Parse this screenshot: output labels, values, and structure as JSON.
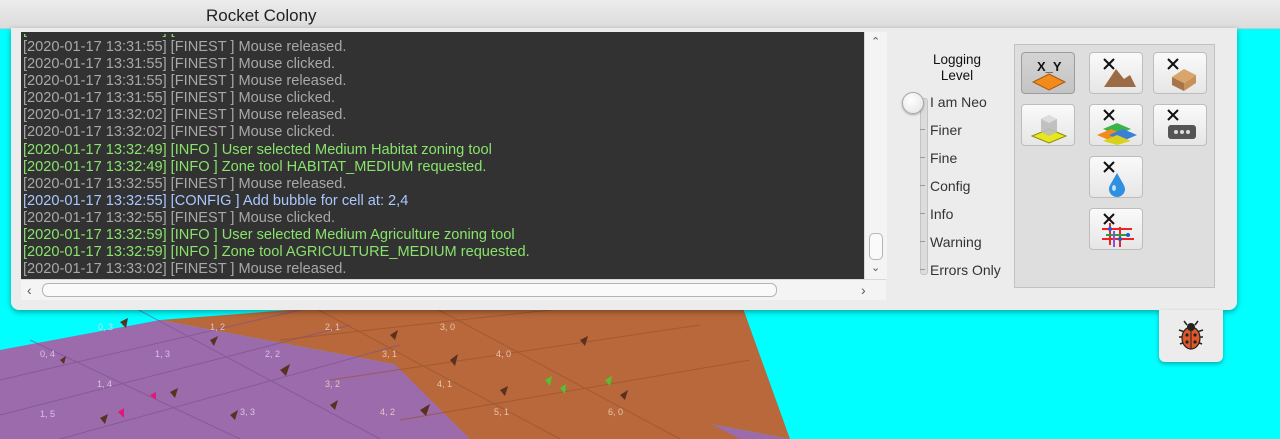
{
  "window": {
    "title": "Rocket Colony"
  },
  "console": {
    "lines": [
      {
        "text": "[2020-01-17 13:31:55] [FINEST ] Mouse released.",
        "level": "FINEST"
      },
      {
        "text": "[2020-01-17 13:31:55] [FINEST ] Mouse clicked.",
        "level": "FINEST"
      },
      {
        "text": "[2020-01-17 13:31:55] [FINEST ] Mouse released.",
        "level": "FINEST"
      },
      {
        "text": "[2020-01-17 13:31:55] [FINEST ] Mouse clicked.",
        "level": "FINEST"
      },
      {
        "text": "[2020-01-17 13:32:02] [FINEST ] Mouse released.",
        "level": "FINEST"
      },
      {
        "text": "[2020-01-17 13:32:02] [FINEST ] Mouse clicked.",
        "level": "FINEST"
      },
      {
        "text": "[2020-01-17 13:32:49] [INFO   ] User selected Medium Habitat zoning tool",
        "level": "INFO"
      },
      {
        "text": "[2020-01-17 13:32:49] [INFO   ] Zone tool HABITAT_MEDIUM requested.",
        "level": "INFO"
      },
      {
        "text": "[2020-01-17 13:32:55] [FINEST ] Mouse released.",
        "level": "FINEST"
      },
      {
        "text": "[2020-01-17 13:32:55] [CONFIG ] Add bubble for cell at: 2,4",
        "level": "CONFIG"
      },
      {
        "text": "[2020-01-17 13:32:55] [FINEST ] Mouse clicked.",
        "level": "FINEST"
      },
      {
        "text": "[2020-01-17 13:32:59] [INFO   ] User selected Medium Agriculture zoning tool",
        "level": "INFO"
      },
      {
        "text": "[2020-01-17 13:32:59] [INFO   ] Zone tool AGRICULTURE_MEDIUM requested.",
        "level": "INFO"
      },
      {
        "text": "[2020-01-17 13:33:02] [FINEST ] Mouse released.",
        "level": "FINEST"
      }
    ]
  },
  "logging": {
    "title": "Logging Level",
    "levels": [
      "I am Neo",
      "Finer",
      "Fine",
      "Config",
      "Info",
      "Warning",
      "Errors Only"
    ],
    "selected": "I am Neo"
  },
  "tools": [
    {
      "icon": "xy-coordinates-icon",
      "selected": true,
      "label": "X_Y"
    },
    {
      "icon": "clear-terrain-icon",
      "selected": false
    },
    {
      "icon": "clear-building-icon",
      "selected": false
    },
    {
      "icon": "layer-zone-icon",
      "selected": false
    },
    {
      "icon": "clear-zones-icon",
      "selected": false
    },
    {
      "icon": "clear-machine-icon",
      "selected": false
    },
    {
      "icon": "clear-water-icon",
      "selected": false
    },
    {
      "icon": "clear-network-icon",
      "selected": false
    }
  ],
  "map": {
    "cell_labels": [
      "0,3",
      "1,2",
      "2,1",
      "3,0",
      "0,4",
      "1,3",
      "2,2",
      "3,1",
      "4,0",
      "1,4",
      "3,2",
      "4,1",
      "1,5",
      "3,3",
      "4,2",
      "5,1",
      "6,0"
    ]
  },
  "debug": {
    "icon": "bug-icon"
  }
}
